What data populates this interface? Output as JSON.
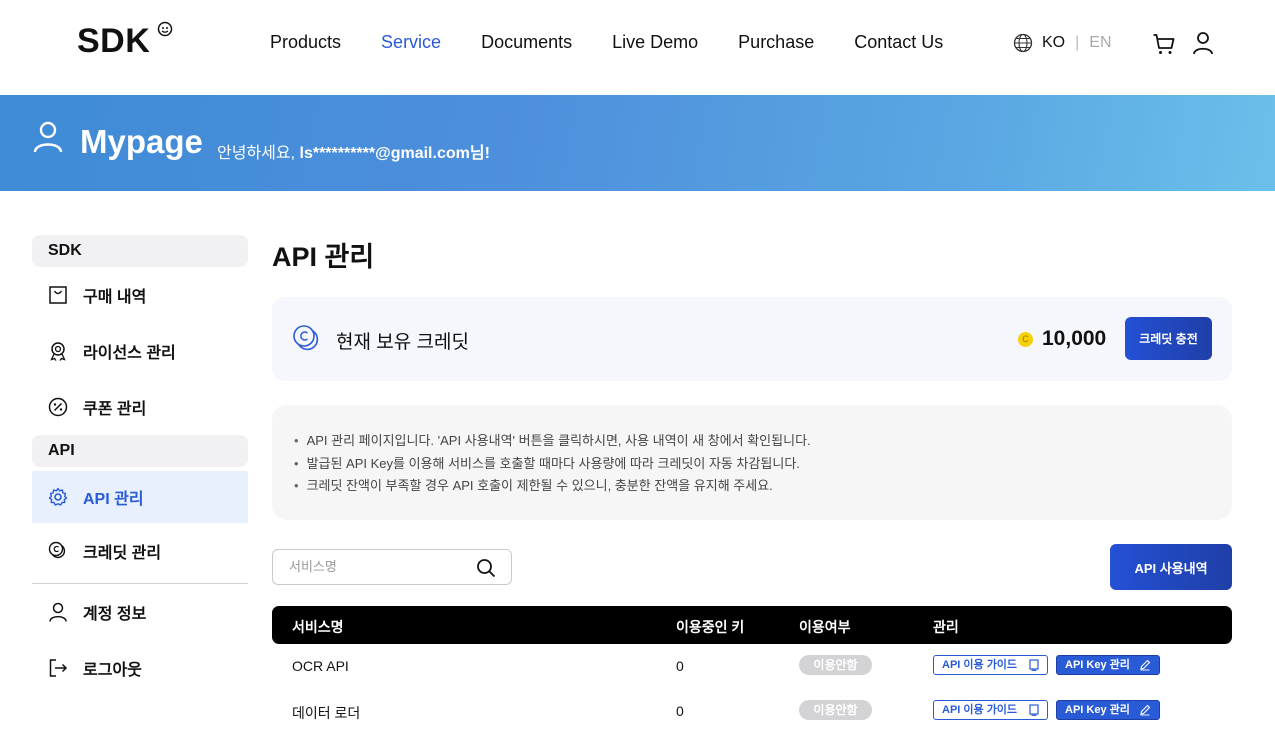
{
  "header": {
    "logo": "SDK",
    "nav": [
      "Products",
      "Service",
      "Documents",
      "Live Demo",
      "Purchase",
      "Contact Us"
    ],
    "active_nav": "Service",
    "lang_ko": "KO",
    "lang_sep": "|",
    "lang_en": "EN"
  },
  "banner": {
    "title": "Mypage",
    "greeting_prefix": "안녕하세요, ",
    "email": "ls**********@gmail.com",
    "greeting_suffix": "님!"
  },
  "sidebar": {
    "group1": "SDK",
    "items1": [
      "구매 내역",
      "라이선스 관리",
      "쿠폰 관리"
    ],
    "group2": "API",
    "items2": [
      "API 관리",
      "크레딧 관리"
    ],
    "items3": [
      "계정 정보",
      "로그아웃"
    ]
  },
  "main": {
    "title": "API 관리",
    "credit_label": "현재 보유 크레딧",
    "coin_symbol": "C",
    "credit_amount": "10,000",
    "charge_button": "크레딧 충전",
    "notices": [
      "API 관리 페이지입니다. 'API 사용내역' 버튼을 클릭하시면, 사용 내역이 새 창에서 확인됩니다.",
      "발급된 API Key를 이용해 서비스를 호출할 때마다 사용량에 따라 크레딧이 자동 차감됩니다.",
      "크레딧 잔액이 부족할 경우 API 호출이 제한될 수 있으니, 충분한 잔액을 유지해 주세요."
    ],
    "search_placeholder": "서비스명",
    "usage_button": "API 사용내역",
    "table": {
      "headers": [
        "서비스명",
        "이용중인 키",
        "이용여부",
        "관리"
      ],
      "rows": [
        {
          "service": "OCR API",
          "keys": "0",
          "status": "이용안함",
          "guide": "API 이용 가이드",
          "key_mgmt": "API Key 관리"
        },
        {
          "service": "데이터 로더",
          "keys": "0",
          "status": "이용안함",
          "guide": "API 이용 가이드",
          "key_mgmt": "API Key 관리"
        }
      ]
    }
  },
  "colors": {
    "accent": "#2a5bd7",
    "banner_start": "#3f8bd6",
    "banner_end": "#6ac0ea",
    "table_header": "#000000",
    "status_inactive": "#d3d3d6"
  }
}
